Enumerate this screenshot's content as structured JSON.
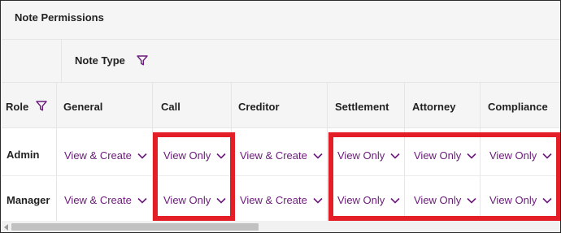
{
  "panel": {
    "title": "Note Permissions",
    "group_label": "Note Type"
  },
  "table": {
    "role_header": "Role",
    "columns": [
      "General",
      "Call",
      "Creditor",
      "Settlement",
      "Attorney",
      "Compliance"
    ],
    "rows": [
      {
        "role": "Admin",
        "values": [
          "View & Create",
          "View Only",
          "View & Create",
          "View Only",
          "View Only",
          "View Only"
        ]
      },
      {
        "role": "Manager",
        "values": [
          "View & Create",
          "View Only",
          "View & Create",
          "View Only",
          "View Only",
          "View Only"
        ]
      }
    ]
  },
  "colors": {
    "accent": "#6b1a7a",
    "highlight": "#e41e26",
    "header_bg": "#f5f5f6"
  },
  "icons": {
    "filter": "funnel-icon",
    "dropdown": "chevron-down-icon"
  }
}
